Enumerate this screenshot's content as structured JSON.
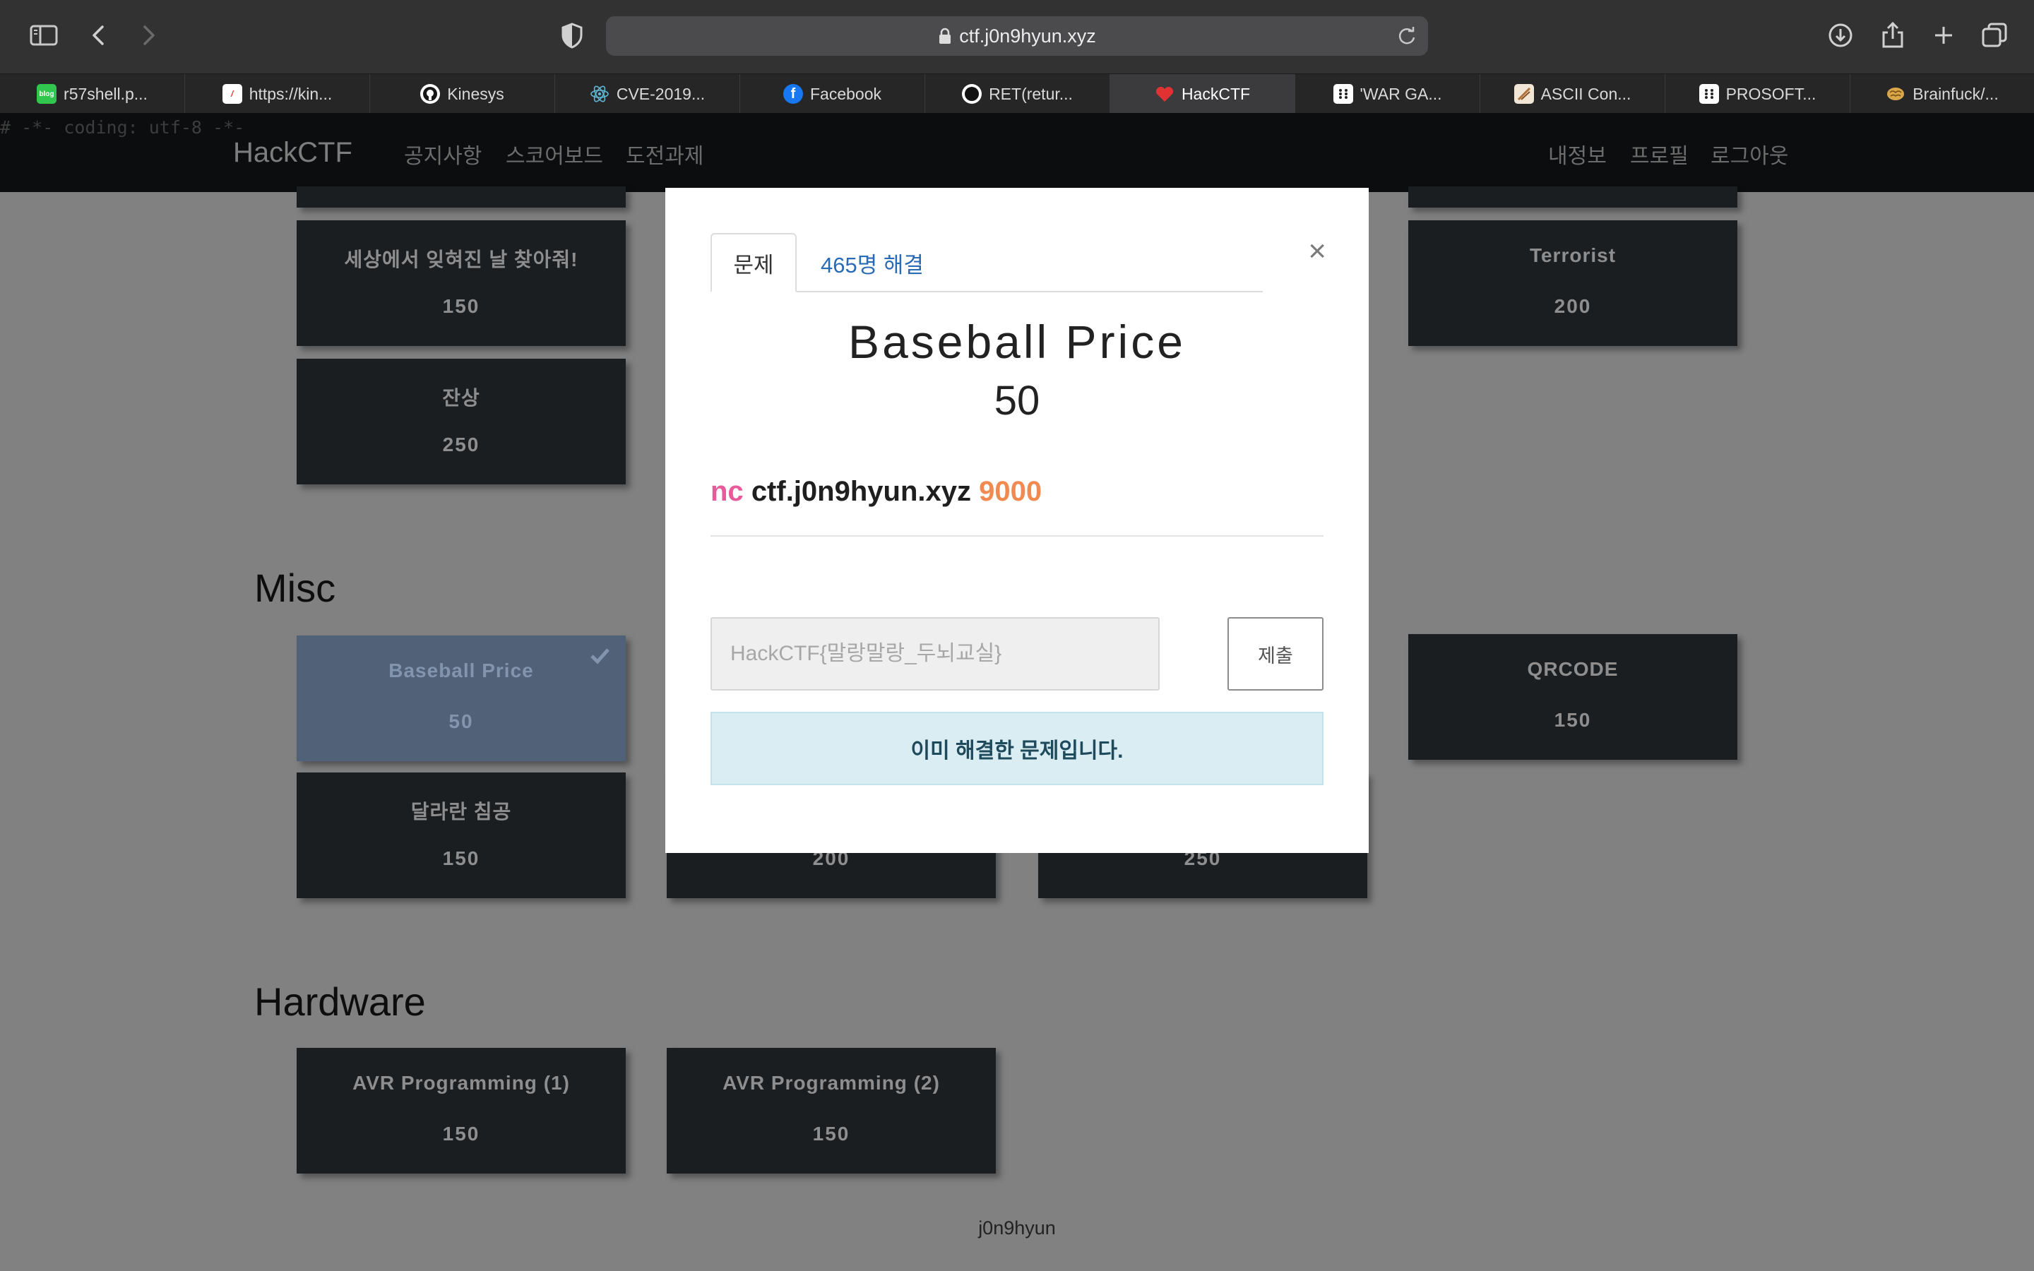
{
  "browser": {
    "url": "ctf.j0n9hyun.xyz",
    "tabs": [
      {
        "label": "r57shell.p...",
        "icon": "blog-icon",
        "color": "#31c64e"
      },
      {
        "label": "https://kin...",
        "icon": "slash-icon",
        "color": "#e23b3b"
      },
      {
        "label": "Kinesys",
        "icon": "github-icon",
        "color": "#ffffff"
      },
      {
        "label": "CVE-2019...",
        "icon": "react-icon",
        "color": "#5fb7d4"
      },
      {
        "label": "Facebook",
        "icon": "facebook-icon",
        "color": "#1877f2"
      },
      {
        "label": "RET(retur...",
        "icon": "circle-icon",
        "color": "#111111"
      },
      {
        "label": "HackCTF",
        "icon": "heart-icon",
        "color": "#e03232",
        "active": true
      },
      {
        "label": "'WAR GA...",
        "icon": "grid-icon",
        "color": "#ffffff"
      },
      {
        "label": "ASCII Con...",
        "icon": "pencil-icon",
        "color": "#c8a37a"
      },
      {
        "label": "PROSOFT...",
        "icon": "grid-icon",
        "color": "#ffffff"
      },
      {
        "label": "Brainfuck/...",
        "icon": "brain-icon",
        "color": "#d9a74a"
      }
    ]
  },
  "page": {
    "comment": "# -*- coding: utf-8 -*-",
    "brand": "HackCTF",
    "nav_left": [
      "공지사항",
      "스코어보드",
      "도전과제"
    ],
    "nav_right": [
      "내정보",
      "프로필",
      "로그아웃"
    ],
    "top_cards": [
      {
        "title": "세상에서 잊혀진 날 찾아줘!",
        "points": "150"
      },
      {
        "title": "잔상",
        "points": "250"
      },
      {
        "title": "Terrorist",
        "points": "200"
      }
    ],
    "misc": {
      "title": "Misc",
      "cards": [
        {
          "title": "Baseball Price",
          "points": "50",
          "solved": true
        },
        {
          "title": "QRCODE",
          "points": "150"
        },
        {
          "title": "달라란 침공",
          "points": "150"
        },
        {
          "title": "",
          "points": "200"
        },
        {
          "title": "",
          "points": "250"
        }
      ]
    },
    "hardware": {
      "title": "Hardware",
      "cards": [
        {
          "title": "AVR Programming (1)",
          "points": "150"
        },
        {
          "title": "AVR Programming (2)",
          "points": "150"
        }
      ]
    },
    "footer": "j0n9hyun"
  },
  "modal": {
    "tab_problem": "문제",
    "tab_solves": "465명 해결",
    "title": "Baseball Price",
    "points": "50",
    "nc_cmd": "nc",
    "nc_host": "ctf.j0n9hyun.xyz",
    "nc_port": "9000",
    "input_placeholder": "HackCTF{말랑말랑_두뇌교실}",
    "submit_label": "제출",
    "alert": "이미 해결한 문제입니다."
  }
}
